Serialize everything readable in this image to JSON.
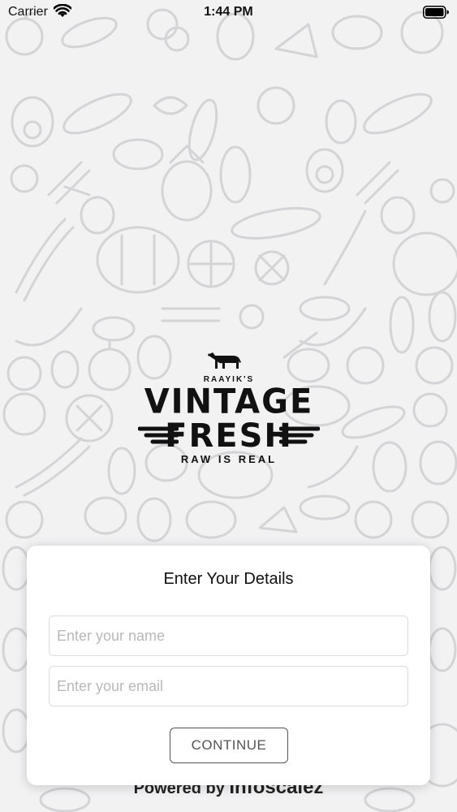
{
  "status_bar": {
    "carrier": "Carrier",
    "time": "1:44 PM",
    "wifi_icon": "wifi-icon",
    "battery_icon": "battery-icon"
  },
  "logo": {
    "prefix": "RAAYIK'S",
    "line1": "VINTAGE",
    "line2": "FRESH",
    "tagline": "RAW IS REAL",
    "emblem_icon": "bull-icon"
  },
  "form": {
    "title": "Enter Your Details",
    "name_placeholder": "Enter your name",
    "name_value": "",
    "email_placeholder": "Enter your email",
    "email_value": "",
    "continue_label": "CONTINUE"
  },
  "footer": {
    "powered_by": "Powered by",
    "brand": "Infoscalez"
  },
  "colors": {
    "background": "#f2f2f3",
    "pattern_stroke": "#d6d6d8",
    "card": "#ffffff",
    "button_border": "#555555"
  }
}
